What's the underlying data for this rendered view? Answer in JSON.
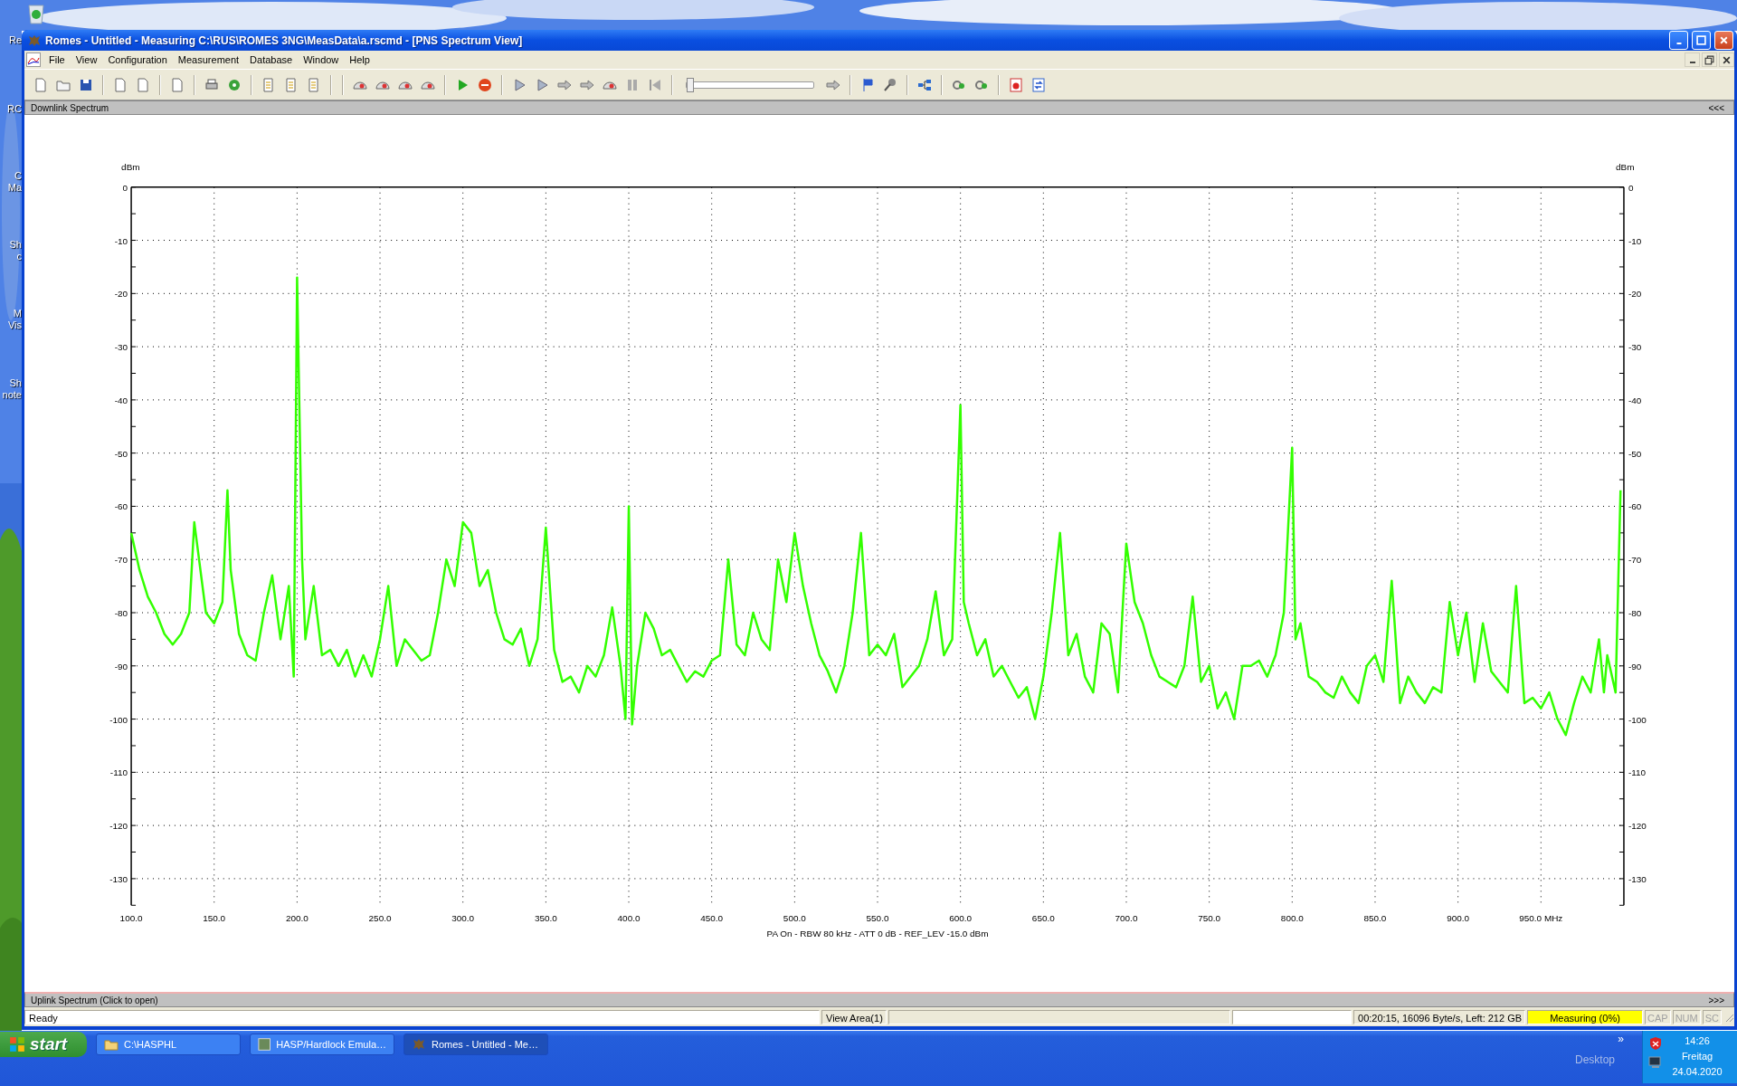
{
  "desktop": {
    "icon_labels": [
      [
        "Re"
      ],
      [
        "RC"
      ],
      [
        "C",
        "Ma"
      ],
      [
        "Sh",
        "c"
      ],
      [
        "M",
        "Vis"
      ],
      [
        "Sh",
        "note"
      ]
    ]
  },
  "window": {
    "title": "Romes - Untitled - Measuring C:\\RUS\\ROMES 3NG\\MeasData\\a.rscmd - [PNS Spectrum View]"
  },
  "menu": [
    "File",
    "View",
    "Configuration",
    "Measurement",
    "Database",
    "Window",
    "Help"
  ],
  "toolbar": {
    "slider": {
      "level": 0
    }
  },
  "downlink_panel": {
    "title": "Downlink Spectrum",
    "toggle": "<<<"
  },
  "chart_data": {
    "type": "line",
    "xlabel": "PA On - RBW 80 kHz - ATT 0 dB - REF_LEV -15.0 dBm",
    "ylabel": "dBm",
    "xlim": [
      100,
      1000
    ],
    "ylim": [
      -135,
      0
    ],
    "xticks": [
      {
        "value": 100,
        "label": "100.0"
      },
      {
        "value": 150,
        "label": "150.0"
      },
      {
        "value": 200,
        "label": "200.0"
      },
      {
        "value": 250,
        "label": "250.0"
      },
      {
        "value": 300,
        "label": "300.0"
      },
      {
        "value": 350,
        "label": "350.0"
      },
      {
        "value": 400,
        "label": "400.0"
      },
      {
        "value": 450,
        "label": "450.0"
      },
      {
        "value": 500,
        "label": "500.0"
      },
      {
        "value": 550,
        "label": "550.0"
      },
      {
        "value": 600,
        "label": "600.0"
      },
      {
        "value": 650,
        "label": "650.0"
      },
      {
        "value": 700,
        "label": "700.0"
      },
      {
        "value": 750,
        "label": "750.0"
      },
      {
        "value": 800,
        "label": "800.0"
      },
      {
        "value": 850,
        "label": "850.0"
      },
      {
        "value": 900,
        "label": "900.0"
      },
      {
        "value": 950,
        "label": "950.0 MHz"
      }
    ],
    "yticks": [
      0,
      -10,
      -20,
      -30,
      -40,
      -50,
      -60,
      -70,
      -80,
      -90,
      -100,
      -110,
      -120,
      -130
    ],
    "y2label": "dBm",
    "y2lim": [
      -135,
      0
    ],
    "grid": true,
    "y2ticks": [
      0,
      -10,
      -20,
      -30,
      -40,
      -50,
      -60,
      -70,
      -80,
      -90,
      -100,
      -110,
      -120,
      -130
    ],
    "x": [
      100,
      105,
      110,
      115,
      120,
      125,
      130,
      135,
      138,
      145,
      150,
      155,
      158,
      160,
      165,
      170,
      175,
      180,
      185,
      190,
      195,
      198,
      200,
      203,
      205,
      210,
      215,
      220,
      225,
      230,
      235,
      240,
      245,
      250,
      255,
      260,
      265,
      270,
      275,
      280,
      285,
      290,
      295,
      300,
      305,
      310,
      315,
      320,
      325,
      330,
      335,
      340,
      345,
      350,
      355,
      360,
      365,
      370,
      375,
      380,
      385,
      390,
      395,
      398,
      400,
      402,
      405,
      410,
      415,
      420,
      425,
      430,
      435,
      440,
      445,
      450,
      455,
      460,
      465,
      470,
      475,
      480,
      485,
      490,
      495,
      500,
      505,
      510,
      515,
      520,
      525,
      530,
      535,
      540,
      545,
      550,
      555,
      560,
      565,
      570,
      575,
      580,
      585,
      590,
      595,
      600,
      602,
      605,
      610,
      615,
      620,
      625,
      630,
      635,
      640,
      645,
      650,
      655,
      660,
      665,
      670,
      675,
      680,
      685,
      690,
      695,
      700,
      705,
      710,
      715,
      720,
      725,
      730,
      735,
      740,
      745,
      750,
      755,
      760,
      765,
      770,
      775,
      780,
      785,
      790,
      795,
      800,
      802,
      805,
      810,
      815,
      820,
      825,
      830,
      835,
      840,
      845,
      850,
      855,
      860,
      865,
      870,
      875,
      880,
      885,
      890,
      895,
      900,
      905,
      910,
      915,
      920,
      925,
      930,
      935,
      940,
      945,
      950,
      955,
      960,
      965,
      970,
      975,
      980,
      985,
      988,
      990,
      995,
      998
    ],
    "series": [
      {
        "color": "#33ff00",
        "values": [
          -65,
          -72,
          -77,
          -80,
          -84,
          -86,
          -84,
          -80,
          -63,
          -80,
          -82,
          -78,
          -57,
          -72,
          -84,
          -88,
          -89,
          -80,
          -73,
          -85,
          -75,
          -92,
          -17,
          -70,
          -85,
          -75,
          -88,
          -87,
          -90,
          -87,
          -92,
          -88,
          -92,
          -85,
          -75,
          -90,
          -85,
          -87,
          -89,
          -88,
          -80,
          -70,
          -75,
          -63,
          -65,
          -75,
          -72,
          -80,
          -85,
          -86,
          -83,
          -90,
          -85,
          -64,
          -87,
          -93,
          -92,
          -95,
          -90,
          -92,
          -88,
          -79,
          -90,
          -100,
          -60,
          -101,
          -90,
          -80,
          -83,
          -88,
          -87,
          -90,
          -93,
          -91,
          -92,
          -89,
          -88,
          -70,
          -86,
          -88,
          -80,
          -85,
          -87,
          -70,
          -78,
          -65,
          -75,
          -82,
          -88,
          -91,
          -95,
          -90,
          -80,
          -65,
          -88,
          -86,
          -88,
          -84,
          -94,
          -92,
          -90,
          -85,
          -76,
          -88,
          -85,
          -41,
          -78,
          -82,
          -88,
          -85,
          -92,
          -90,
          -93,
          -96,
          -94,
          -100,
          -92,
          -80,
          -65,
          -88,
          -84,
          -92,
          -95,
          -82,
          -84,
          -95,
          -67,
          -78,
          -82,
          -88,
          -92,
          -93,
          -94,
          -90,
          -77,
          -93,
          -90,
          -98,
          -95,
          -100,
          -90,
          -90,
          -89,
          -92,
          -88,
          -80,
          -49,
          -85,
          -82,
          -92,
          -93,
          -95,
          -96,
          -92,
          -95,
          -97,
          -90,
          -88,
          -93,
          -74,
          -97,
          -92,
          -95,
          -97,
          -94,
          -95,
          -78,
          -88,
          -80,
          -93,
          -82,
          -91,
          -93,
          -95,
          -75,
          -97,
          -96,
          -98,
          -95,
          -100,
          -103,
          -97,
          -92,
          -95,
          -85,
          -95,
          -88,
          -95,
          -57
        ]
      }
    ]
  },
  "uplink_panel": {
    "title": "Uplink Spectrum (Click to open)",
    "toggle": ">>>"
  },
  "status_bar": {
    "message": "Ready",
    "view": "View Area(1)",
    "stats": "00:20:15, 16096 Byte/s, Left: 212 GB",
    "measuring": "Measuring (0%)",
    "indicators": [
      {
        "label": "CAP",
        "active": false
      },
      {
        "label": "NUM",
        "active": false
      },
      {
        "label": "SC",
        "active": false
      }
    ]
  },
  "taskbar": {
    "start": "start",
    "tasks": [
      {
        "label": "C:\\HASPHL",
        "selected": false
      },
      {
        "label": "HASP/Hardlock Emula…",
        "selected": false
      },
      {
        "label": "Romes - Untitled - Me…",
        "selected": true
      }
    ],
    "chevron": "»",
    "toolbar_label": "Desktop",
    "clock": {
      "time": "14:26",
      "day": "Freitag",
      "date": "24.04.2020"
    }
  }
}
